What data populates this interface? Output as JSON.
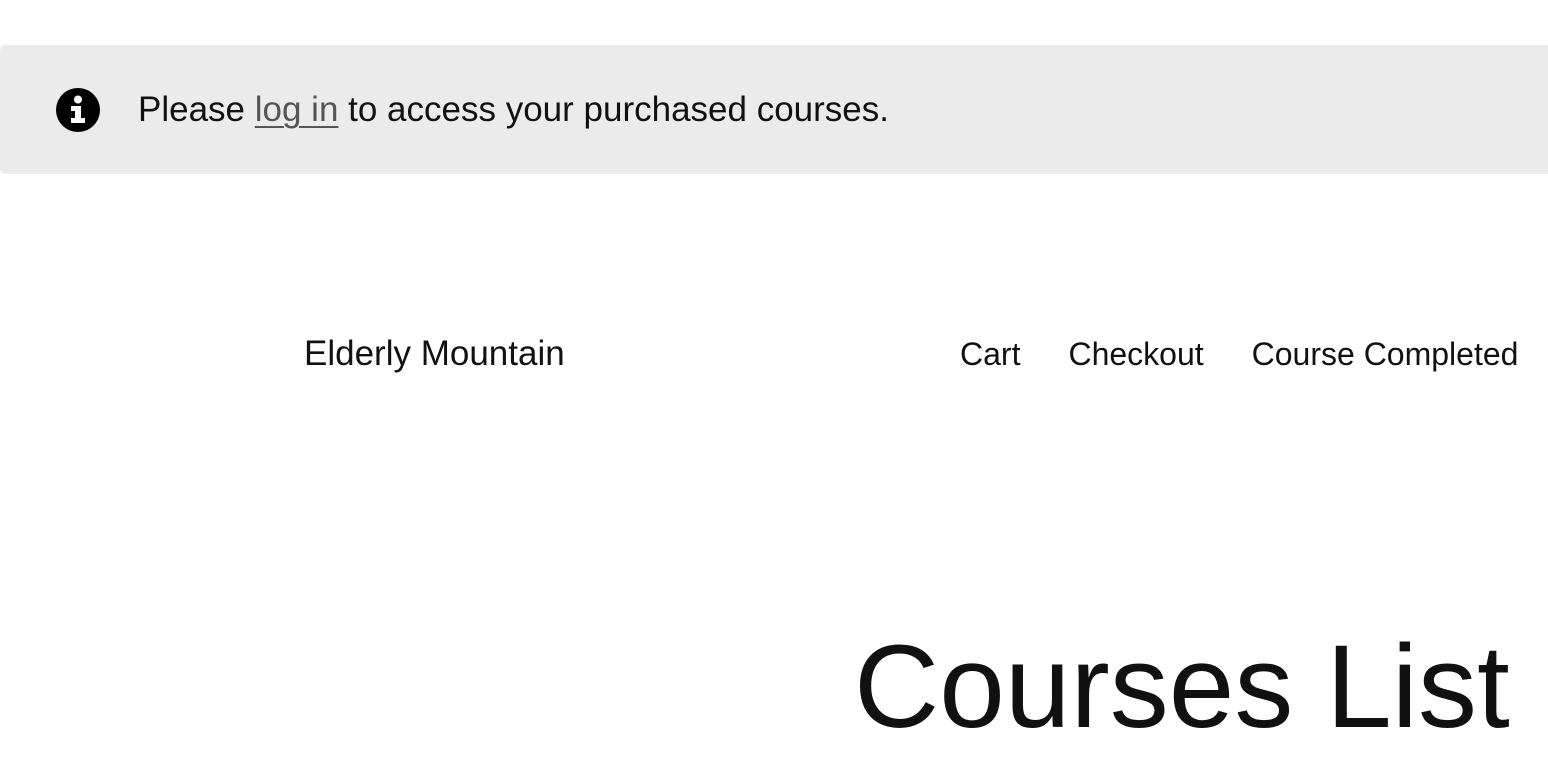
{
  "notice": {
    "icon": "info-circle-icon",
    "text_before": "Please ",
    "link_label": "log in",
    "text_after": " to access your purchased courses.",
    "background": "#ebebeb"
  },
  "header": {
    "site_title": "Elderly Mountain",
    "nav": [
      {
        "label": "Cart"
      },
      {
        "label": "Checkout"
      },
      {
        "label": "Course Completed"
      }
    ]
  },
  "main": {
    "title": "Courses List"
  }
}
